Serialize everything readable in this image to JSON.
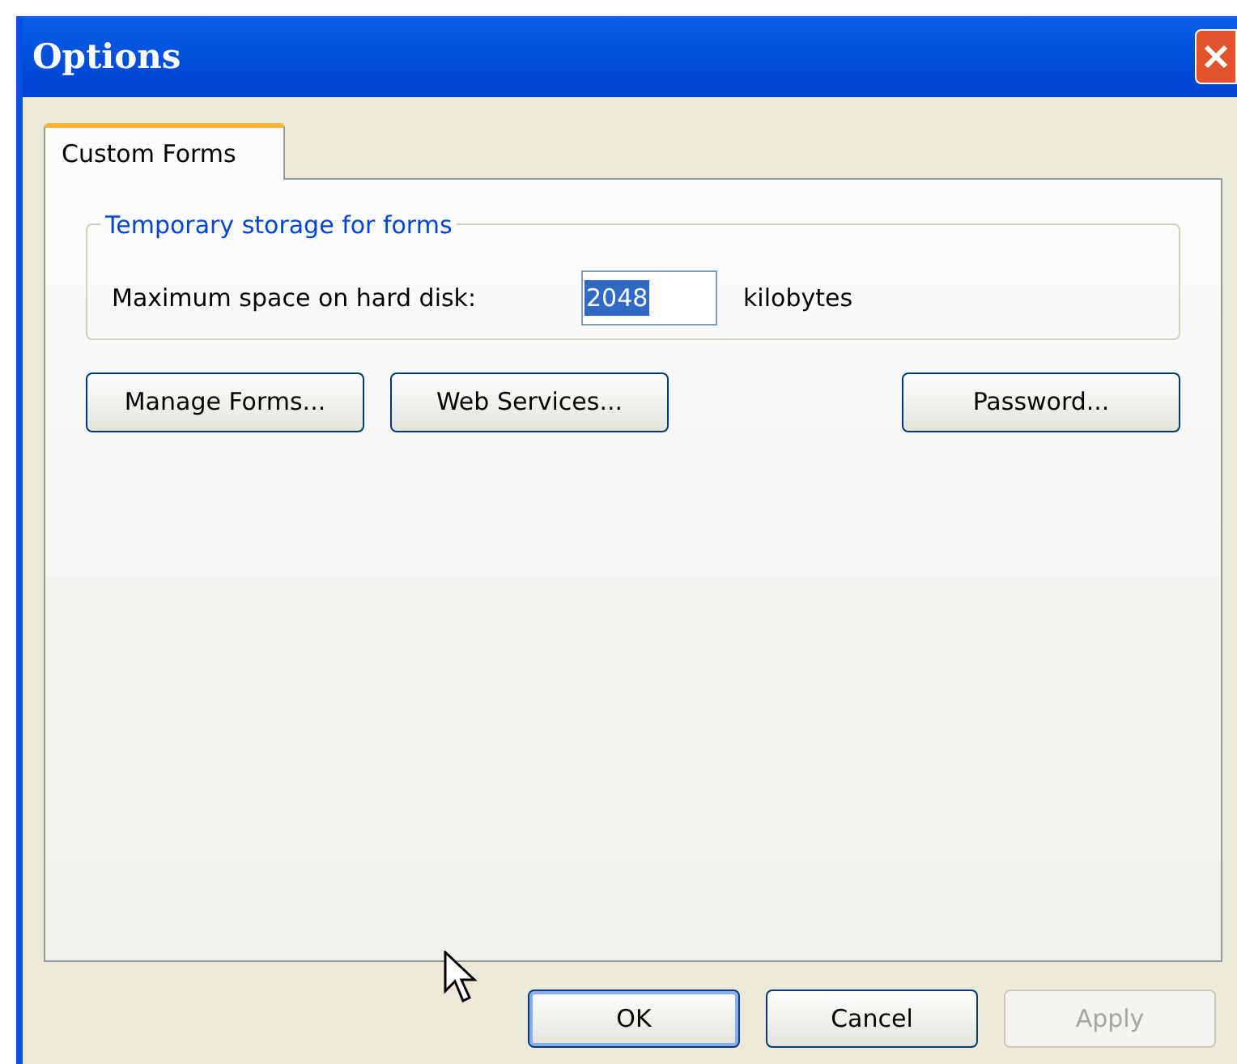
{
  "window": {
    "title": "Options"
  },
  "tabs": [
    {
      "label": "Custom Forms",
      "selected": true
    }
  ],
  "group": {
    "title": "Temporary storage for forms",
    "label": "Maximum space on hard disk:",
    "value": "2048",
    "value_selected": true,
    "unit": "kilobytes"
  },
  "actions": [
    {
      "label": "Manage Forms..."
    },
    {
      "label": "Web Services..."
    },
    {
      "label": "Password..."
    }
  ],
  "buttons": [
    {
      "label": "OK",
      "default": true,
      "disabled": false
    },
    {
      "label": "Cancel",
      "default": false,
      "disabled": false
    },
    {
      "label": "Apply",
      "default": false,
      "disabled": true
    }
  ]
}
